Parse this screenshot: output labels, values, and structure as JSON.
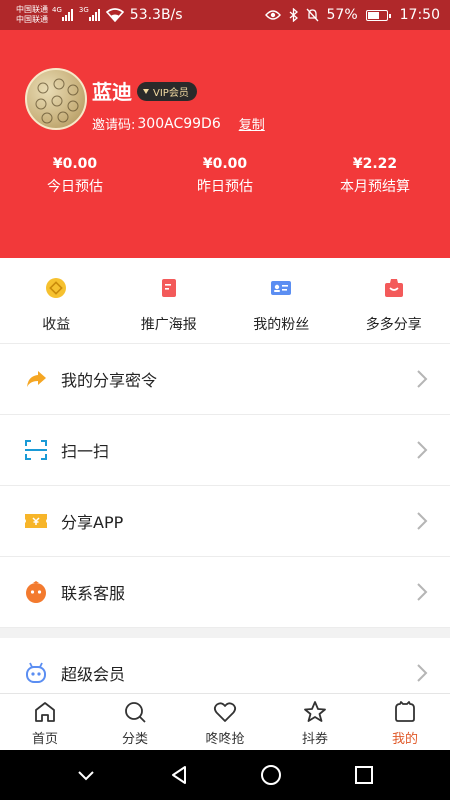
{
  "status_bar": {
    "carrier1": "中国联通",
    "carrier2": "中国联通",
    "net1": "4G",
    "net2": "3G",
    "speed": "53.3B/s",
    "battery": "57%",
    "time": "17:50"
  },
  "profile": {
    "name": "蓝迪",
    "vip_badge": "VIP会员",
    "invite_label": "邀请码:",
    "invite_code": "300AC99D6",
    "copy_label": "复制"
  },
  "stats": [
    {
      "value": "¥0.00",
      "label": "今日预估"
    },
    {
      "value": "¥0.00",
      "label": "昨日预估"
    },
    {
      "value": "¥2.22",
      "label": "本月预结算"
    }
  ],
  "quick_actions": [
    {
      "label": "收益",
      "icon": "coin-icon"
    },
    {
      "label": "推广海报",
      "icon": "poster-icon"
    },
    {
      "label": "我的粉丝",
      "icon": "fans-card-icon"
    },
    {
      "label": "多多分享",
      "icon": "share-bag-icon"
    }
  ],
  "menu": [
    {
      "label": "我的分享密令",
      "icon": "share-arrow-icon"
    },
    {
      "label": "扫一扫",
      "icon": "scan-icon"
    },
    {
      "label": "分享APP",
      "icon": "ticket-icon"
    },
    {
      "label": "联系客服",
      "icon": "service-icon"
    },
    {
      "label": "超级会员",
      "icon": "robot-icon"
    }
  ],
  "tabs": [
    {
      "label": "首页",
      "icon": "home-icon"
    },
    {
      "label": "分类",
      "icon": "search-icon"
    },
    {
      "label": "咚咚抢",
      "icon": "heart-icon"
    },
    {
      "label": "抖券",
      "icon": "star-icon"
    },
    {
      "label": "我的",
      "icon": "profile-icon",
      "active": true
    }
  ],
  "colors": {
    "header_red": "#f2393a",
    "status_bar": "#b0282a",
    "active_tab": "#e05a2a"
  }
}
